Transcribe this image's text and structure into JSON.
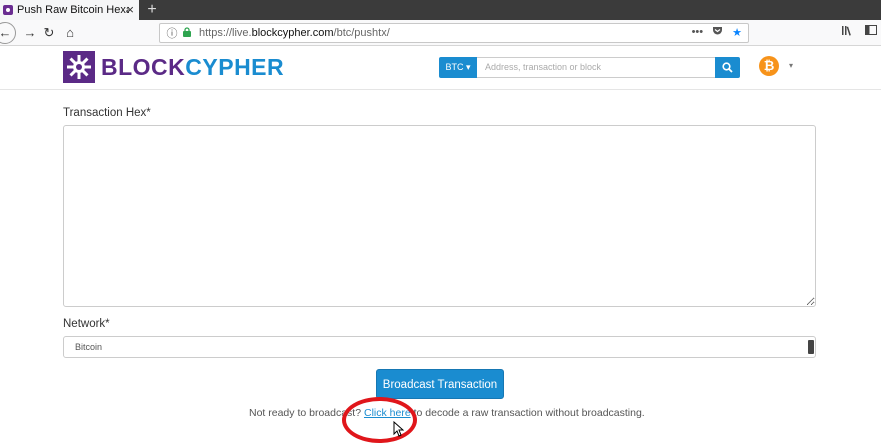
{
  "browser": {
    "tab_title": "Push Raw Bitcoin Hexade",
    "tab_close": "×",
    "new_tab": "+",
    "url_prefix": "https://live.",
    "url_domain": "blockcypher.com",
    "url_path": "/btc/pushtx/",
    "url_more": "•••",
    "icons": [
      "back-icon",
      "forward-icon",
      "reload-icon",
      "home-icon",
      "info-icon",
      "lock-icon",
      "pocket-icon",
      "star-icon",
      "library-icon",
      "sidebar-icon"
    ]
  },
  "header": {
    "logo_block": "BLOCK",
    "logo_cypher": "CYPHER",
    "coin_label": "BTC ▾",
    "search_placeholder": "Address, transaction or block",
    "bitcoin_symbol": "₿",
    "caret": "▾"
  },
  "form": {
    "hex_label": "Transaction Hex*",
    "hex_value": "",
    "network_label": "Network*",
    "network_selected": "Bitcoin",
    "broadcast_label": "Broadcast Transaction",
    "footer_before": "Not ready to broadcast? ",
    "footer_link": "Click here",
    "footer_after": " to decode a raw transaction without broadcasting."
  },
  "colors": {
    "brand_purple": "#5b2a86",
    "brand_blue": "#1a8cd0",
    "bitcoin_orange": "#f7931a",
    "annotation_red": "#e0161b"
  }
}
